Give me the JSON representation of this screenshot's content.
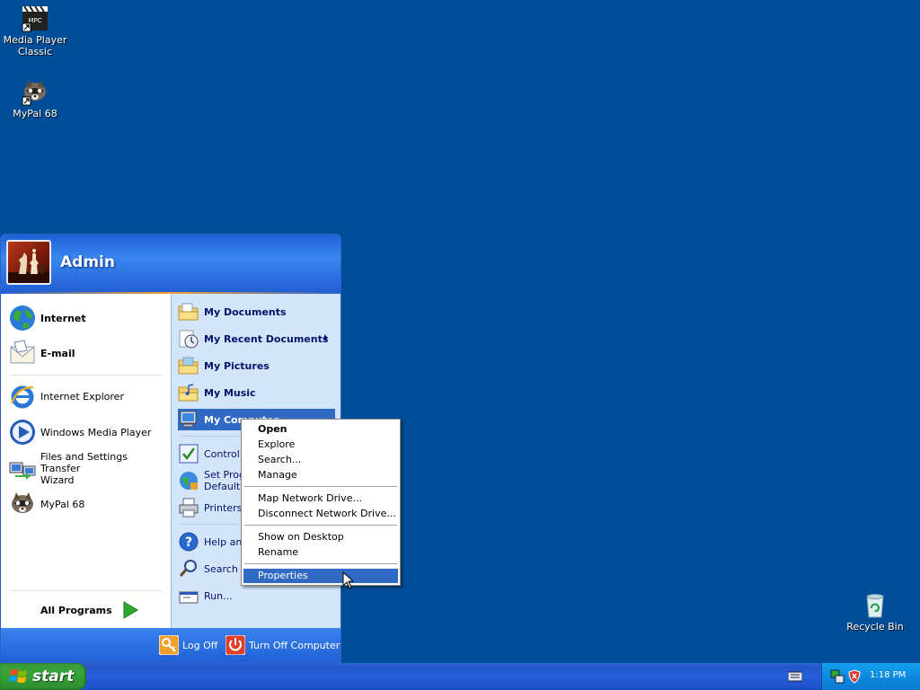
{
  "desktop": {
    "icons": [
      {
        "label_line1": "Media Player",
        "label_line2": "Classic",
        "icon": "media-player-classic-icon"
      },
      {
        "label_line1": "MyPal 68",
        "label_line2": "",
        "icon": "mypal-icon"
      },
      {
        "label_line1": "Recycle Bin",
        "label_line2": "",
        "icon": "recycle-bin-icon"
      }
    ]
  },
  "start_menu": {
    "user": "Admin",
    "pinned": [
      {
        "label": "Internet",
        "icon": "globe-icon"
      },
      {
        "label": "E-mail",
        "icon": "email-icon"
      }
    ],
    "recent": [
      {
        "label": "Internet Explorer",
        "icon": "internet-explorer-icon"
      },
      {
        "label": "Windows Media Player",
        "icon": "media-player-icon"
      },
      {
        "label_line1": "Files and Settings Transfer",
        "label_line2": "Wizard",
        "icon": "transfer-wizard-icon"
      },
      {
        "label": "MyPal 68",
        "icon": "mypal-icon"
      }
    ],
    "all_programs": "All Programs",
    "right": [
      {
        "label": "My Documents",
        "icon": "folder-icon"
      },
      {
        "label": "My Recent Documents",
        "icon": "recent-docs-icon"
      },
      {
        "label": "My Pictures",
        "icon": "folder-icon"
      },
      {
        "label": "My Music",
        "icon": "folder-icon"
      },
      {
        "label": "My Computer",
        "icon": "computer-icon"
      },
      {
        "label": "Control P",
        "icon": "control-panel-icon"
      },
      {
        "label_line1": "Set Prog",
        "label_line2": "Defaults",
        "icon": "program-defaults-icon"
      },
      {
        "label": "Printers a",
        "icon": "printer-icon"
      },
      {
        "label": "Help and",
        "icon": "help-icon"
      },
      {
        "label": "Search",
        "icon": "search-icon"
      },
      {
        "label": "Run...",
        "icon": "run-icon"
      }
    ],
    "footer": {
      "log_off": "Log Off",
      "turn_off": "Turn Off Computer"
    }
  },
  "context_menu": {
    "items": [
      "Open",
      "Explore",
      "Search...",
      "Manage",
      "Map Network Drive...",
      "Disconnect Network Drive...",
      "Show on Desktop",
      "Rename",
      "Properties"
    ],
    "default_item": "Open",
    "highlighted_item": "Properties"
  },
  "taskbar": {
    "start_label": "start",
    "clock": "1:18 PM"
  },
  "colors": {
    "desktop": "#004e98",
    "taskbar": "#245edb",
    "start_button": "#37a337",
    "selection": "#316ac5",
    "tray": "#0c8ae0"
  }
}
